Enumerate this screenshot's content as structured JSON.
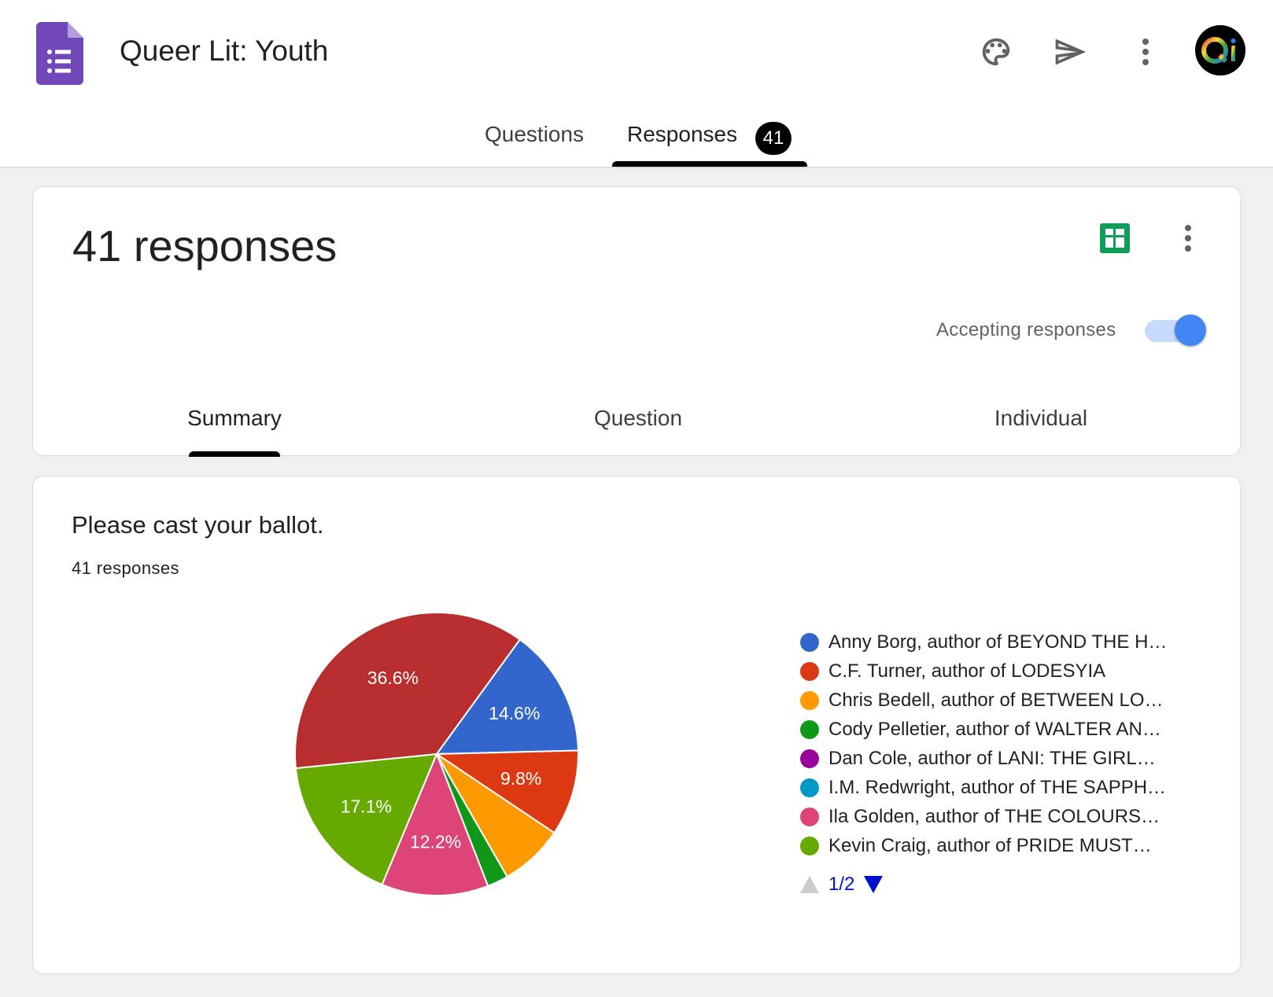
{
  "header": {
    "form_title": "Queer Lit: Youth",
    "icons": [
      "forms-logo-icon",
      "palette-icon",
      "send-icon",
      "more-vert-icon",
      "avatar"
    ],
    "avatar_text": "Qi"
  },
  "main_tabs": {
    "questions": "Questions",
    "responses": "Responses",
    "responses_count": "41",
    "active": "responses"
  },
  "summary_card": {
    "title": "41 responses",
    "accepting_label": "Accepting responses",
    "accepting": true,
    "tabs": [
      "Summary",
      "Question",
      "Individual"
    ],
    "active_tab": "Summary",
    "sheets_color": "#0f9d58"
  },
  "question_card": {
    "title": "Please cast your ballot.",
    "response_count": "41 responses",
    "pager": "1/2"
  },
  "chart_data": {
    "type": "pie",
    "slices": [
      {
        "label": "Anny Borg, author of BEYOND THE H…",
        "value": 14.6,
        "color": "#3366cc",
        "text": "14.6%"
      },
      {
        "label": "C.F. Turner, author of LODESYIA",
        "value": 9.8,
        "color": "#dc3912",
        "text": "9.8%"
      },
      {
        "label": "Chris Bedell, author of BETWEEN LO…",
        "value": 7.3,
        "color": "#ff9900",
        "text": ""
      },
      {
        "label": "Cody Pelletier, author of WALTER AN…",
        "value": 2.4,
        "color": "#109618",
        "text": ""
      },
      {
        "label": "Dan Cole, author of LANI: THE GIRL…",
        "value": 0,
        "color": "#990099",
        "text": ""
      },
      {
        "label": "I.M. Redwright, author of THE SAPPH…",
        "value": 0,
        "color": "#0099c6",
        "text": ""
      },
      {
        "label": "Ila Golden, author of THE COLOURS…",
        "value": 12.2,
        "color": "#dd4477",
        "text": "12.2%"
      },
      {
        "label": "Kevin Craig, author of PRIDE MUST…",
        "value": 17.1,
        "color": "#66aa00",
        "text": "17.1%"
      },
      {
        "label": "",
        "value": 36.6,
        "color": "#b82e2e",
        "text": "36.6%"
      }
    ],
    "legend_items": [
      0,
      1,
      2,
      3,
      4,
      5,
      6,
      7
    ]
  }
}
